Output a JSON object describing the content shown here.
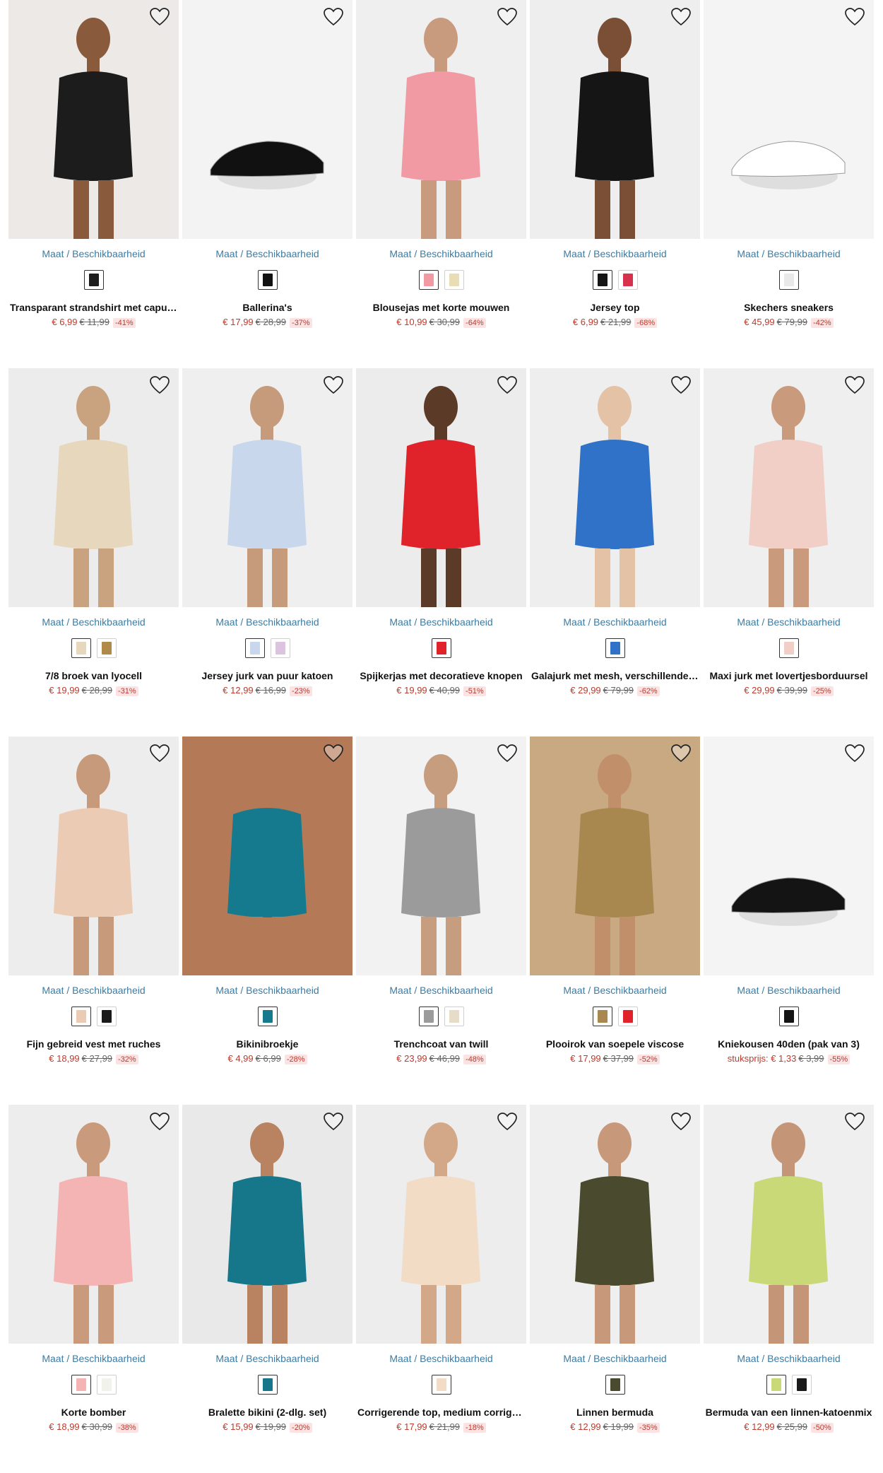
{
  "avail_label": "Maat / Beschikbaarheid",
  "products": [
    {
      "name": "Transparant strandshirt met capuchon",
      "price": "€ 6,99",
      "was": "€ 11,99",
      "discount": "-41%",
      "bg": "#ece9e6",
      "garment": "#1c1c1c",
      "skin": "#8a5a3c",
      "swatches": [
        "#1c1c1c"
      ]
    },
    {
      "name": "Ballerina's",
      "price": "€ 17,99",
      "was": "€ 28,99",
      "discount": "-37%",
      "bg": "#f3f3f3",
      "garment": "#111111",
      "skin": "",
      "swatches": [
        "#111111"
      ]
    },
    {
      "name": "Blousejas met korte mouwen",
      "price": "€ 10,99",
      "was": "€ 30,99",
      "discount": "-64%",
      "bg": "#efefef",
      "garment": "#f29aa3",
      "skin": "#c89a7e",
      "swatches": [
        "#f29aa3",
        "#e8ddb5"
      ]
    },
    {
      "name": "Jersey top",
      "price": "€ 6,99",
      "was": "€ 21,99",
      "discount": "-68%",
      "bg": "#eeeeee",
      "garment": "#151515",
      "skin": "#7a4f36",
      "swatches": [
        "#151515",
        "#d6324e"
      ]
    },
    {
      "name": "Skechers sneakers",
      "price": "€ 45,99",
      "was": "€ 79,99",
      "discount": "-42%",
      "bg": "#f4f4f4",
      "garment": "#ffffff",
      "skin": "",
      "swatches": [
        "#e9e9e9"
      ]
    },
    {
      "name": "7/8 broek van lyocell",
      "price": "€ 19,99",
      "was": "€ 28,99",
      "discount": "-31%",
      "bg": "#ececec",
      "garment": "#e6d7bd",
      "skin": "#c9a27f",
      "swatches": [
        "#e6d7bd",
        "#b08a48"
      ]
    },
    {
      "name": "Jersey jurk van puur katoen",
      "price": "€ 12,99",
      "was": "€ 16,99",
      "discount": "-23%",
      "bg": "#efefef",
      "garment": "#c9d7ec",
      "skin": "#c59b7b",
      "swatches": [
        "#c9d7ec",
        "#dcc3e0"
      ]
    },
    {
      "name": "Spijkerjas met decoratieve knopen",
      "price": "€ 19,99",
      "was": "€ 40,99",
      "discount": "-51%",
      "bg": "#ececec",
      "garment": "#e0222a",
      "skin": "#5b3a28",
      "swatches": [
        "#e0222a"
      ]
    },
    {
      "name": "Galajurk met mesh, verschillende draagwijzen",
      "price": "€ 29,99",
      "was": "€ 79,99",
      "discount": "-62%",
      "bg": "#eeeeee",
      "garment": "#2f72c8",
      "skin": "#e4c2a6",
      "swatches": [
        "#2f72c8"
      ]
    },
    {
      "name": "Maxi jurk met lovertjesborduursel",
      "price": "€ 29,99",
      "was": "€ 39,99",
      "discount": "-25%",
      "bg": "#efefef",
      "garment": "#f1cfc6",
      "skin": "#c99a7c",
      "swatches": [
        "#f1cfc6"
      ]
    },
    {
      "name": "Fijn gebreid vest met ruches",
      "price": "€ 18,99",
      "was": "€ 27,99",
      "discount": "-32%",
      "bg": "#ededed",
      "garment": "#eccbb4",
      "skin": "#c69a7a",
      "swatches": [
        "#eccbb4",
        "#1a1a1a"
      ]
    },
    {
      "name": "Bikinibroekje",
      "price": "€ 4,99",
      "was": "€ 6,99",
      "discount": "-28%",
      "bg": "#b47a57",
      "garment": "#167a8e",
      "skin": "#b47a57",
      "swatches": [
        "#167a8e"
      ]
    },
    {
      "name": "Trenchcoat van twill",
      "price": "€ 23,99",
      "was": "€ 46,99",
      "discount": "-48%",
      "bg": "#f2f2f2",
      "garment": "#9b9b9b",
      "skin": "#c79d80",
      "swatches": [
        "#9b9b9b",
        "#e6dcc8"
      ]
    },
    {
      "name": "Plooirok van soepele viscose",
      "price": "€ 17,99",
      "was": "€ 37,99",
      "discount": "-52%",
      "bg": "#c9a982",
      "garment": "#a8884f",
      "skin": "#c28f6b",
      "swatches": [
        "#a8884f",
        "#e0232b"
      ]
    },
    {
      "name": "Kniekousen 40den (pak van 3)",
      "price_prefix": "stuksprijs:",
      "price": "€ 1,33",
      "was": "€ 3,99",
      "discount": "-55%",
      "bg": "#f4f4f4",
      "garment": "#141414",
      "skin": "",
      "swatches": [
        "#141414"
      ]
    },
    {
      "name": "Korte bomber",
      "price": "€ 18,99",
      "was": "€ 30,99",
      "discount": "-38%",
      "bg": "#ededed",
      "garment": "#f4b4b4",
      "skin": "#c99b7c",
      "swatches": [
        "#f4b4b4",
        "#f2f2ec"
      ]
    },
    {
      "name": "Bralette bikini (2-dlg. set)",
      "price": "€ 15,99",
      "was": "€ 19,99",
      "discount": "-20%",
      "bg": "#e9e9e9",
      "garment": "#16768a",
      "skin": "#b98261",
      "swatches": [
        "#16768a"
      ]
    },
    {
      "name": "Corrigerende top, medium corrigerend",
      "price": "€ 17,99",
      "was": "€ 21,99",
      "discount": "-18%",
      "bg": "#ededed",
      "garment": "#f2dcc6",
      "skin": "#d3a888",
      "swatches": [
        "#f2dcc6"
      ]
    },
    {
      "name": "Linnen bermuda",
      "price": "€ 12,99",
      "was": "€ 19,99",
      "discount": "-35%",
      "bg": "#efefef",
      "garment": "#4a4a2e",
      "skin": "#c7997a",
      "swatches": [
        "#4a4a2e"
      ]
    },
    {
      "name": "Bermuda van een linnen-katoenmix",
      "price": "€ 12,99",
      "was": "€ 25,99",
      "discount": "-50%",
      "bg": "#efefef",
      "garment": "#c9d978",
      "skin": "#c49677",
      "swatches": [
        "#c9d978",
        "#1a1a1a"
      ]
    }
  ]
}
